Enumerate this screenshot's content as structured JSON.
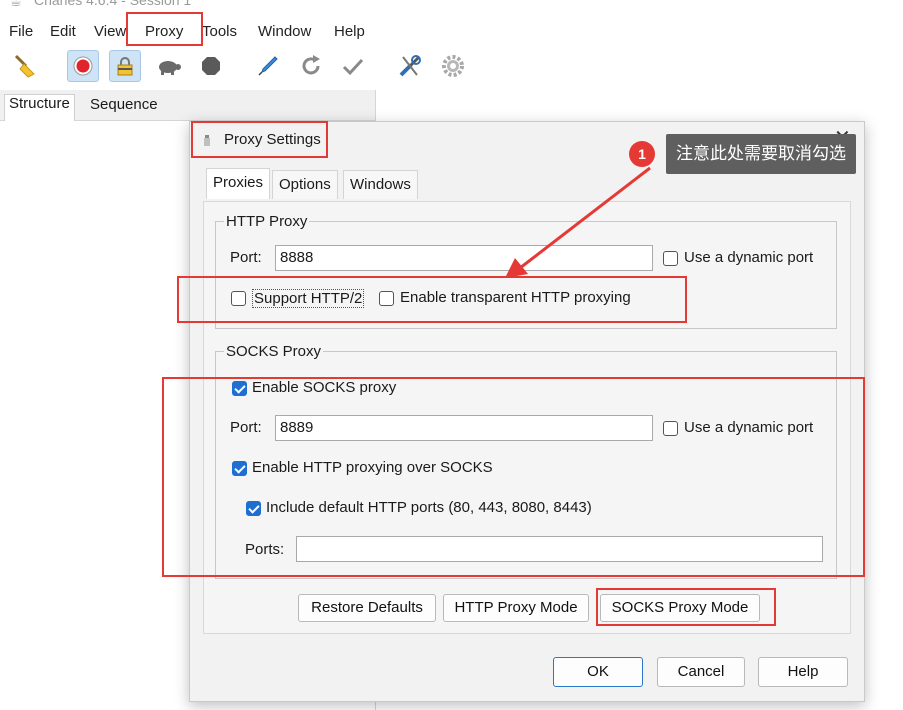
{
  "window": {
    "title": "Charles 4.6.4 - Session 1"
  },
  "menu": [
    "File",
    "Edit",
    "View",
    "Proxy",
    "Tools",
    "Window",
    "Help"
  ],
  "toolbar": {
    "icons": [
      "broom-icon",
      "record-icon",
      "ssl-proxying-icon",
      "throttle-turtle-icon",
      "breakpoints-stop-icon",
      "compose-pen-icon",
      "repeat-icon",
      "validate-check-icon",
      "tools-icon",
      "settings-gear-icon"
    ]
  },
  "left_panel": {
    "tabs": [
      "Structure",
      "Sequence"
    ]
  },
  "dialog": {
    "title": "Proxy Settings",
    "tabs": [
      "Proxies",
      "Options",
      "Windows"
    ],
    "http_proxy": {
      "group_title": "HTTP Proxy",
      "port_label": "Port:",
      "port_value": "8888",
      "dynamic_port_label": "Use a dynamic port",
      "dynamic_port_checked": false,
      "http2_label": "Support HTTP/2",
      "http2_checked": false,
      "transparent_label": "Enable transparent HTTP proxying",
      "transparent_checked": false
    },
    "socks_proxy": {
      "group_title": "SOCKS Proxy",
      "enable_label": "Enable SOCKS proxy",
      "enable_checked": true,
      "port_label": "Port:",
      "port_value": "8889",
      "dynamic_port_label": "Use a dynamic port",
      "dynamic_port_checked": false,
      "http_over_socks_label": "Enable HTTP proxying over SOCKS",
      "http_over_socks_checked": true,
      "default_ports_label": "Include default HTTP ports (80, 443, 8080, 8443)",
      "default_ports_checked": true,
      "ports_label": "Ports:",
      "ports_value": ""
    },
    "mode_buttons": [
      "Restore Defaults",
      "HTTP Proxy Mode",
      "SOCKS Proxy Mode"
    ],
    "footer_buttons": {
      "ok": "OK",
      "cancel": "Cancel",
      "help": "Help"
    }
  },
  "annotation": {
    "badge": "1",
    "note": "注意此处需要取消勾选",
    "color": "#e53935"
  }
}
